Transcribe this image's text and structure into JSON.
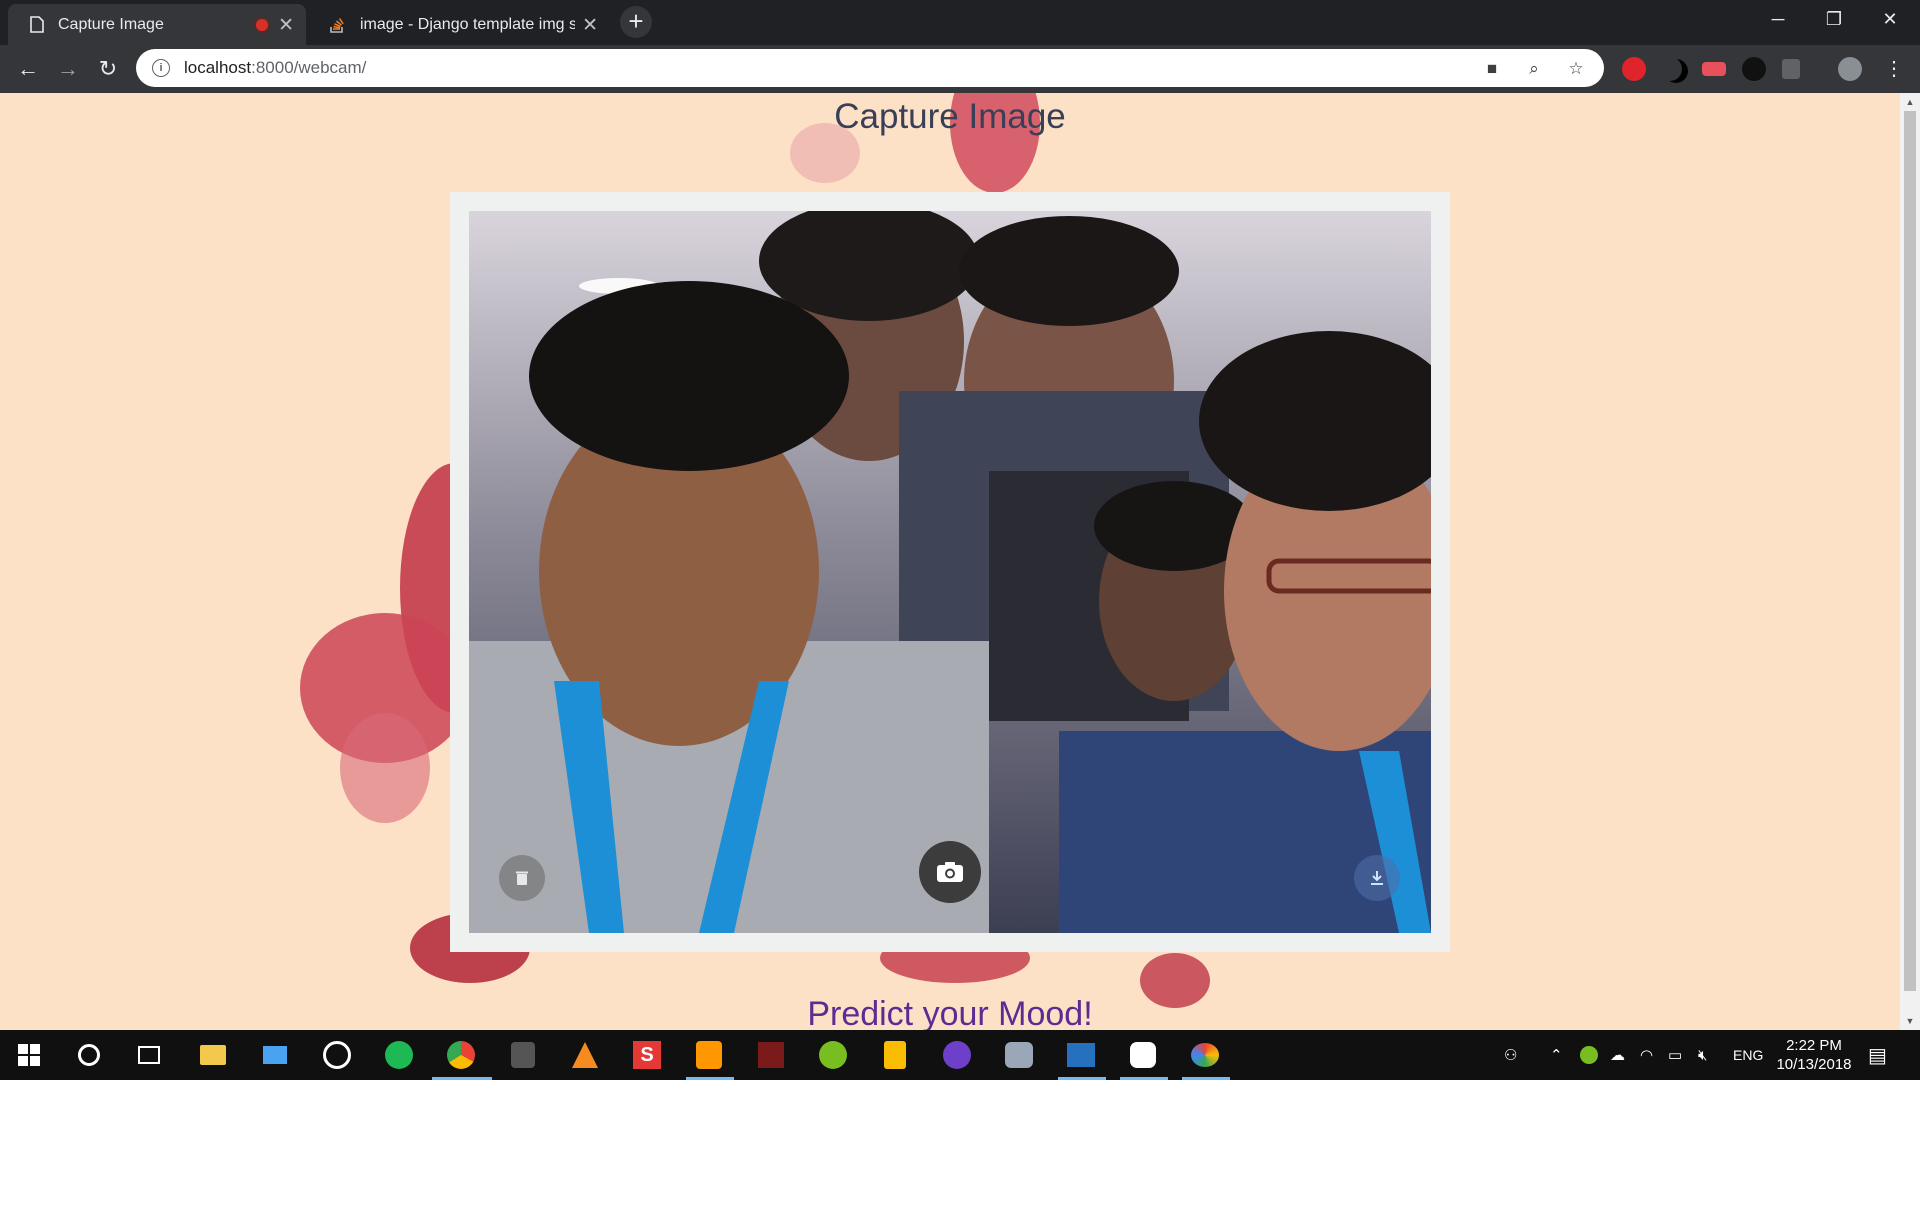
{
  "browser": {
    "tabs": [
      {
        "title": "Capture Image",
        "active": true,
        "recording": true
      },
      {
        "title": "image - Django template img src",
        "active": false
      }
    ],
    "new_tab_label": "+",
    "url_host": "localhost",
    "url_path": ":8000/webcam/"
  },
  "page": {
    "title": "Capture Image",
    "subtitle": "Predict your Mood!",
    "colors": {
      "background": "#fde1c7",
      "title": "#3a3f58",
      "subtitle": "#5b2c91",
      "frame": "#eff0f0",
      "ink": "#c8404e"
    },
    "camera": {
      "delete_icon": "trash-icon",
      "capture_icon": "camera-icon",
      "download_icon": "download-icon"
    }
  },
  "taskbar": {
    "apps": [
      "windows-start",
      "cortana",
      "task-view",
      "file-explorer",
      "remote-desktop",
      "groove",
      "spotify",
      "chrome",
      "predator",
      "vlc",
      "s-app",
      "sublime-text",
      "predator-sense",
      "utorrent",
      "keep",
      "github",
      "tree",
      "powershell",
      "slack",
      "paint"
    ],
    "tray_language": "ENG",
    "clock_time": "2:22 PM",
    "clock_date": "10/13/2018"
  }
}
